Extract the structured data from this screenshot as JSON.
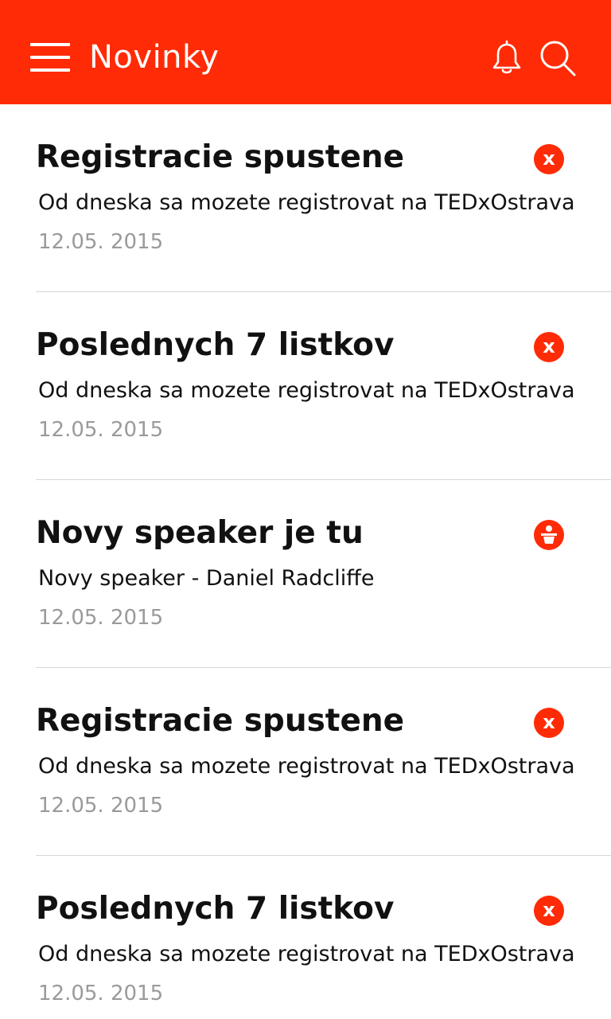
{
  "header": {
    "title": "Novinky",
    "background_color": "#ff2b06",
    "icons": [
      "menu-icon",
      "bell-icon",
      "search-icon"
    ]
  },
  "news": [
    {
      "title": "Registracie spustene",
      "description": "Od dneska sa mozete registrovat na TEDxOstrava",
      "date": "12.05. 2015",
      "icon": "close-icon"
    },
    {
      "title": "Poslednych 7 listkov",
      "description": "Od dneska sa mozete registrovat na TEDxOstrava",
      "date": "12.05. 2015",
      "icon": "close-icon"
    },
    {
      "title": "Novy speaker je tu",
      "description": "Novy speaker - Daniel Radcliffe",
      "date": "12.05. 2015",
      "icon": "speaker-icon"
    },
    {
      "title": "Registracie spustene",
      "description": "Od dneska sa mozete registrovat na TEDxOstrava",
      "date": "12.05. 2015",
      "icon": "close-icon"
    },
    {
      "title": "Poslednych 7 listkov",
      "description": "Od dneska sa mozete registrovat na TEDxOstrava",
      "date": "12.05. 2015",
      "icon": "close-icon"
    }
  ]
}
